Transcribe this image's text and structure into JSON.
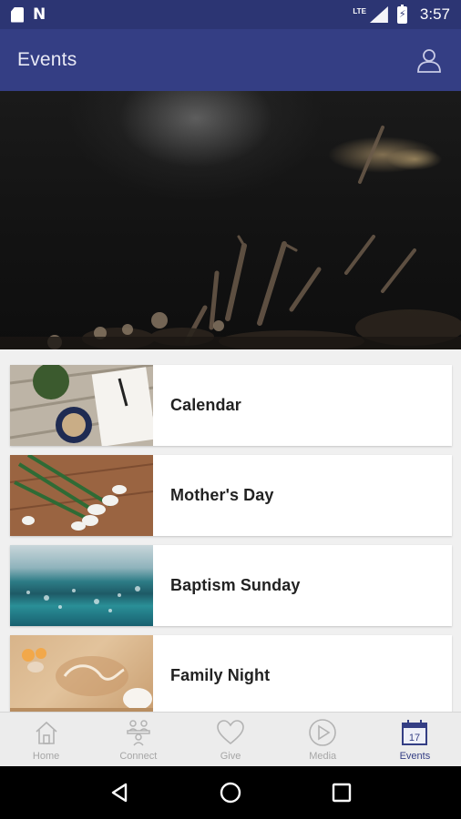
{
  "status_bar": {
    "network_label": "LTE",
    "time": "3:57"
  },
  "app_bar": {
    "title": "Events"
  },
  "events": [
    {
      "title": "Calendar"
    },
    {
      "title": "Mother's Day"
    },
    {
      "title": "Baptism Sunday"
    },
    {
      "title": "Family Night"
    }
  ],
  "bottom_nav": {
    "items": [
      {
        "label": "Home",
        "icon": "home-icon"
      },
      {
        "label": "Connect",
        "icon": "connect-icon"
      },
      {
        "label": "Give",
        "icon": "heart-icon"
      },
      {
        "label": "Media",
        "icon": "play-icon"
      },
      {
        "label": "Events",
        "icon": "calendar-icon",
        "badge": "17"
      }
    ],
    "active_index": 4
  },
  "colors": {
    "status_bar": "#2c3573",
    "app_bar": "#343e84",
    "accent": "#343e84",
    "inactive_nav": "#a6a6a6"
  }
}
